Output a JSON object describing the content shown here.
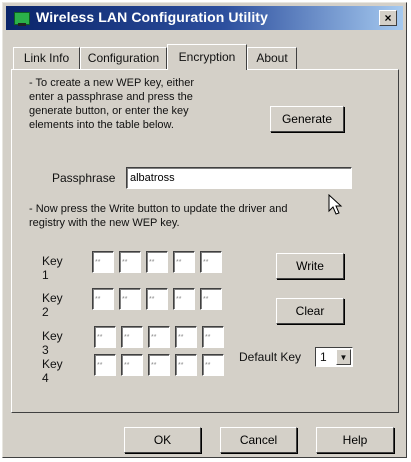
{
  "window": {
    "title": "Wireless LAN Configuration Utility",
    "close_glyph": "×"
  },
  "tabs": [
    {
      "label": "Link Info",
      "active": false
    },
    {
      "label": "Configuration",
      "active": false
    },
    {
      "label": "Encryption",
      "active": true
    },
    {
      "label": "About",
      "active": false
    }
  ],
  "encryption": {
    "instructions_1": "- To create a new WEP key, either\nenter a passphrase and press the\ngenerate button, or enter the key\nelements into the table below.",
    "generate_label": "Generate",
    "passphrase_label": "Passphrase",
    "passphrase_value": "albatross",
    "instructions_2": "- Now press the Write button to update the driver and\nregistry with the new WEP key.",
    "keys": [
      {
        "label": "Key 1",
        "cells": [
          "**",
          "**",
          "**",
          "**",
          "**"
        ]
      },
      {
        "label": "Key 2",
        "cells": [
          "**",
          "**",
          "**",
          "**",
          "**"
        ]
      },
      {
        "label": "Key 3",
        "cells": [
          "**",
          "**",
          "**",
          "**",
          "**"
        ]
      },
      {
        "label": "Key 4",
        "cells": [
          "**",
          "**",
          "**",
          "**",
          "**"
        ]
      }
    ],
    "write_label": "Write",
    "clear_label": "Clear",
    "default_key_label": "Default Key",
    "default_key_value": "1"
  },
  "footer": {
    "ok_label": "OK",
    "cancel_label": "Cancel",
    "help_label": "Help"
  },
  "icons": {
    "app": "wireless-network-icon",
    "close": "close-icon",
    "dropdown": "chevron-down-icon",
    "cursor": "mouse-pointer-icon"
  }
}
